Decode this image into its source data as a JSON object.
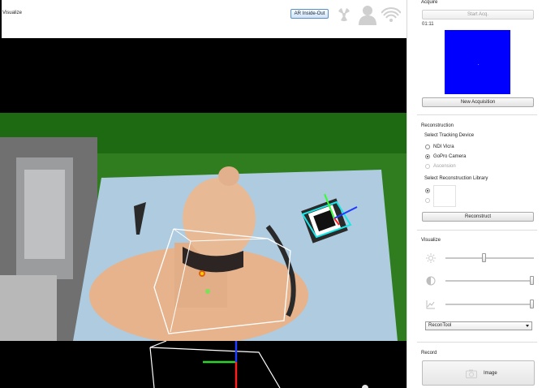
{
  "toolbar": {
    "title": "Visualize",
    "inside_out_button": "AR Inside-Out",
    "icons": [
      "radiation-icon",
      "person-icon",
      "audio-waves-icon"
    ]
  },
  "acquire": {
    "title": "Acquire",
    "start_button": "Start Acq.",
    "timer": "01:11",
    "preview_color": "#0000ff",
    "new_button": "New Acquisition"
  },
  "reconstruction": {
    "title": "Reconstruction",
    "tracking_title": "Select Tracking Device",
    "devices": [
      {
        "label": "NDI Vicra",
        "checked": false,
        "disabled": false
      },
      {
        "label": "GoPro Camera",
        "checked": true,
        "disabled": false
      },
      {
        "label": "Ascension",
        "checked": false,
        "disabled": true
      }
    ],
    "library_title": "Select Reconstruction Library",
    "reconstruct_button": "Reconstruct"
  },
  "visualize": {
    "title": "Visualize",
    "sliders": [
      {
        "icon": "brightness-icon",
        "value": 0.43
      },
      {
        "icon": "contrast-icon",
        "value": 1.0
      },
      {
        "icon": "curve-icon",
        "value": 1.0
      }
    ],
    "selected_tool": "ReconTool"
  },
  "record": {
    "title": "Record",
    "image_button": "Image"
  }
}
